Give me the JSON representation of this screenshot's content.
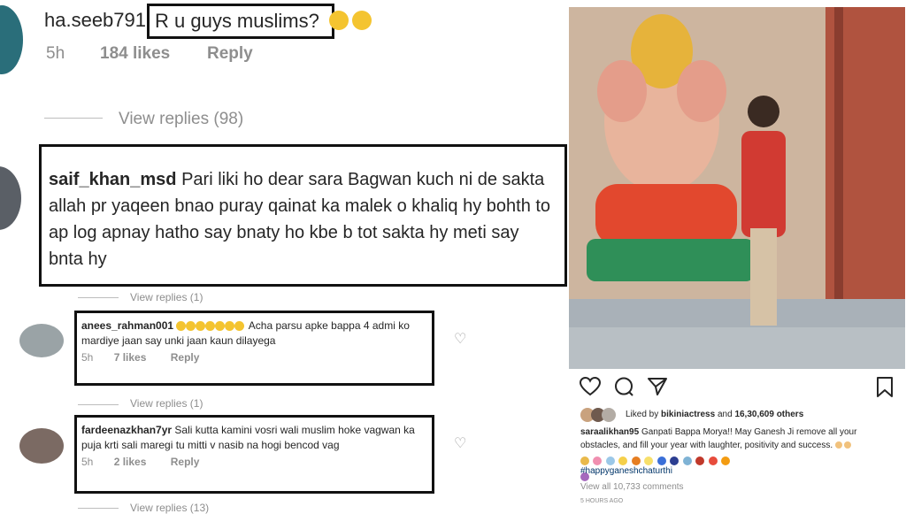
{
  "top": {
    "username": "ha.seeb791",
    "text": "R u guys muslims?",
    "time": "5h",
    "likes": "184 likes",
    "reply": "Reply",
    "view_replies": "View replies (98)"
  },
  "c1": {
    "username": "saif_khan_msd",
    "text": "Pari liki ho dear sara Bagwan kuch ni de sakta allah pr yaqeen bnao puray qainat ka malek o khaliq hy bohth to ap log apnay hatho say bnaty ho kbe b tot sakta hy meti say bnta hy",
    "view_replies": "View replies (1)"
  },
  "c2": {
    "username": "anees_rahman001",
    "text": "Acha parsu apke bappa 4 admi ko mardiye jaan say unki jaan kaun dilayega",
    "time": "5h",
    "likes": "7 likes",
    "reply": "Reply",
    "view_replies": "View replies (1)"
  },
  "c3": {
    "username": "fardeenazkhan7yr",
    "text": "Sali kutta kamini vosri wali muslim hoke vagwan ka puja krti sali maregi tu mitti v nasib na hogi bencod vag",
    "time": "5h",
    "likes": "2 likes",
    "reply": "Reply",
    "view_replies": "View replies (13)"
  },
  "post": {
    "liked_prefix": "Liked by",
    "liked_user": "bikiniactress",
    "liked_and": "and",
    "liked_count": "16,30,609 others",
    "caption_user": "saraalikhan95",
    "caption": "Ganpati Bappa Morya!! May Ganesh Ji remove all your obstacles, and fill your year with laughter, positivity and success.",
    "hashtag": "#happyganeshchaturthi",
    "view_comments": "View all 10,733 comments",
    "time": "5 hours ago"
  },
  "icons": [
    "heart-icon",
    "comment-icon",
    "share-icon",
    "bookmark-icon"
  ],
  "colors": {
    "text": "#262626",
    "meta": "#8e8e8e",
    "link": "#003569",
    "box": "#111111"
  }
}
